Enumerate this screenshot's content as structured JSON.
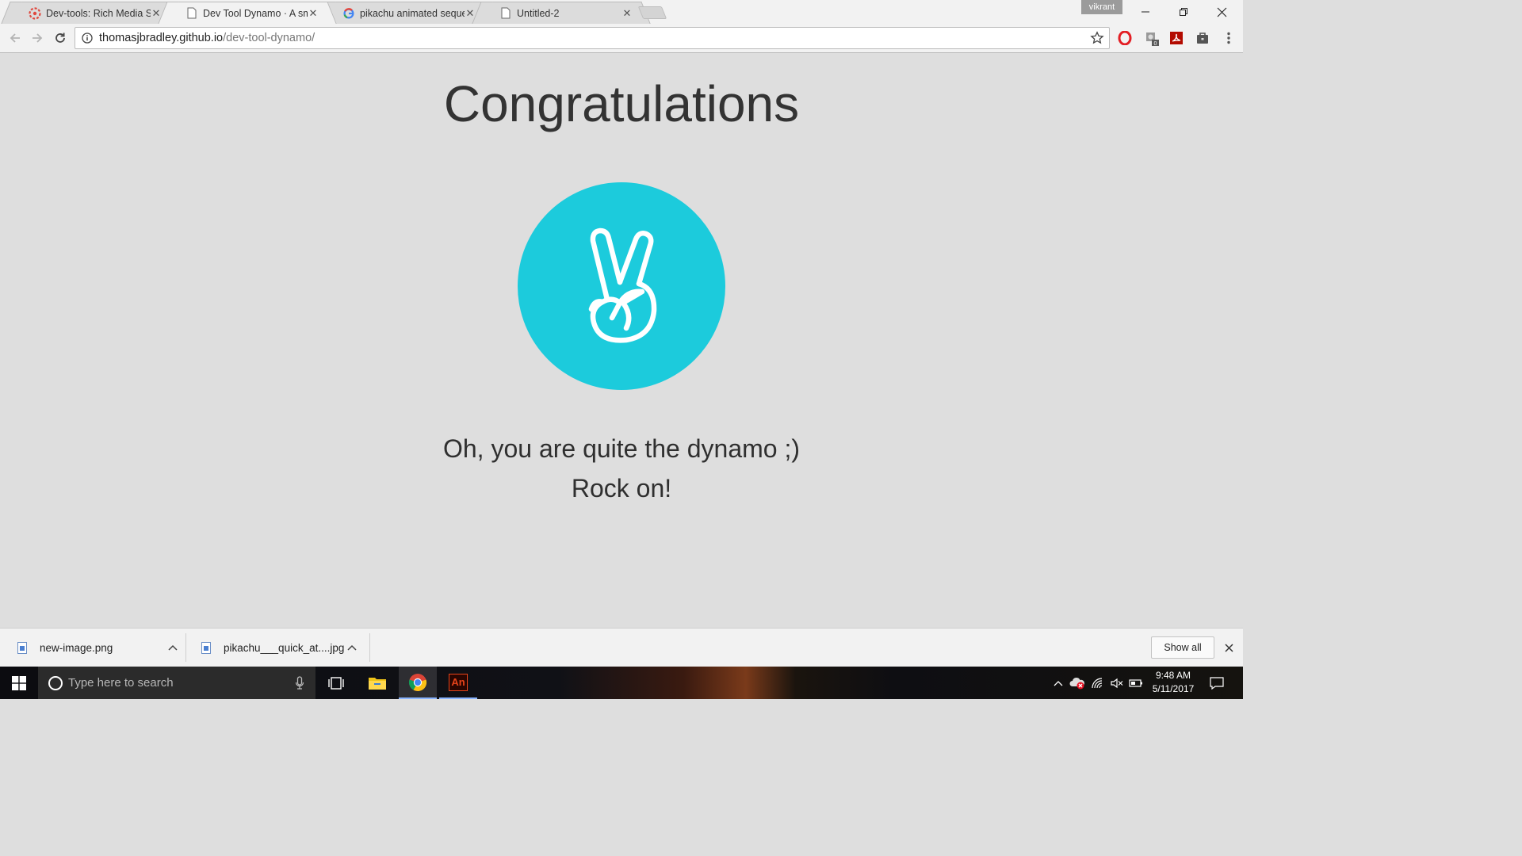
{
  "browser": {
    "tabs": [
      {
        "title": "Dev-tools: Rich Media Se",
        "favicon": "red-gear-icon"
      },
      {
        "title": "Dev Tool Dynamo · A sm",
        "favicon": "page-icon",
        "active": true
      },
      {
        "title": "pikachu animated sequer",
        "favicon": "google-icon"
      },
      {
        "title": "Untitled-2",
        "favicon": "page-icon"
      }
    ],
    "profile_name": "vikrant",
    "address": {
      "host": "thomasjbradley.github.io",
      "path": "/dev-tool-dynamo/"
    },
    "extensions": [
      "opera-icon",
      "extension-badge-icon",
      "acrobat-icon",
      "briefcase-icon"
    ],
    "extension_badge": "0"
  },
  "page": {
    "heading": "Congratulations",
    "line1": "Oh, you are quite the dynamo ;)",
    "line2": "Rock on!",
    "badge_color": "#1ccbdc",
    "badge_icon": "peace-hand-icon"
  },
  "downloads": {
    "items": [
      {
        "filename": "new-image.png"
      },
      {
        "filename": "pikachu___quick_at....jpg"
      }
    ],
    "show_all_label": "Show all"
  },
  "taskbar": {
    "search_placeholder": "Type here to search",
    "apps": [
      "task-view-icon",
      "file-explorer-icon",
      "chrome-icon",
      "animate-icon"
    ],
    "animate_label": "An",
    "time": "9:48 AM",
    "date": "5/11/2017"
  }
}
